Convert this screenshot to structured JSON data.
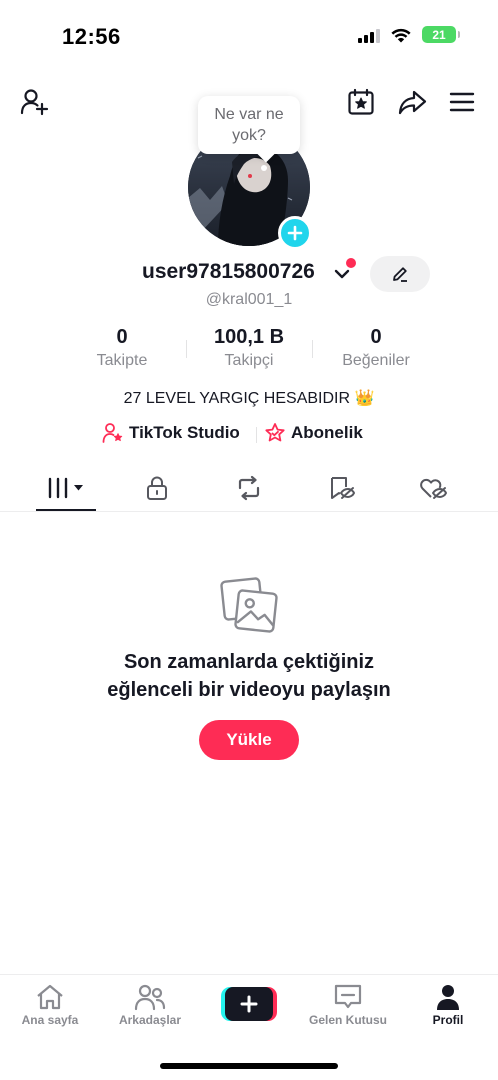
{
  "status_bar": {
    "time": "12:56",
    "battery": "21",
    "icons": [
      "signal-icon",
      "wifi-icon",
      "battery-icon"
    ]
  },
  "top_bar": {
    "icons": [
      "add-friend-icon",
      "calendar-star-icon",
      "share-icon",
      "menu-icon"
    ]
  },
  "profile": {
    "tooltip": "Ne var ne yok?",
    "username": "user97815800726",
    "handle": "@kral001_1",
    "bio": "27 LEVEL YARGIÇ HESABIDIR 👑"
  },
  "stats": [
    {
      "value": "0",
      "label": "Takipte"
    },
    {
      "value": "100,1 B",
      "label": "Takipçi"
    },
    {
      "value": "0",
      "label": "Beğeniler"
    }
  ],
  "links": {
    "studio": "TikTok Studio",
    "subscription": "Abonelik"
  },
  "tabs": {
    "icons": [
      "videos-grid-icon",
      "lock-icon",
      "repost-icon",
      "bookmark-hidden-icon",
      "liked-hidden-icon"
    ],
    "active": "videos-grid-icon"
  },
  "empty_state": {
    "title_line1": "Son zamanlarda çektiğiniz",
    "title_line2": "eğlenceli bir videoyu paylaşın",
    "button": "Yükle"
  },
  "bottom_nav": {
    "items": [
      {
        "label": "Ana sayfa",
        "icon": "home-icon"
      },
      {
        "label": "Arkadaşlar",
        "icon": "friends-icon"
      },
      {
        "label": "",
        "icon": "create-plus-icon"
      },
      {
        "label": "Gelen Kutusu",
        "icon": "inbox-icon"
      },
      {
        "label": "Profil",
        "icon": "profile-icon"
      }
    ],
    "active": "Profil"
  },
  "colors": {
    "accent": "#fe2c55",
    "cyan": "#25f4ee",
    "avatar_plus": "#20d5ec",
    "text": "#161823",
    "muted": "#8a8b91"
  }
}
